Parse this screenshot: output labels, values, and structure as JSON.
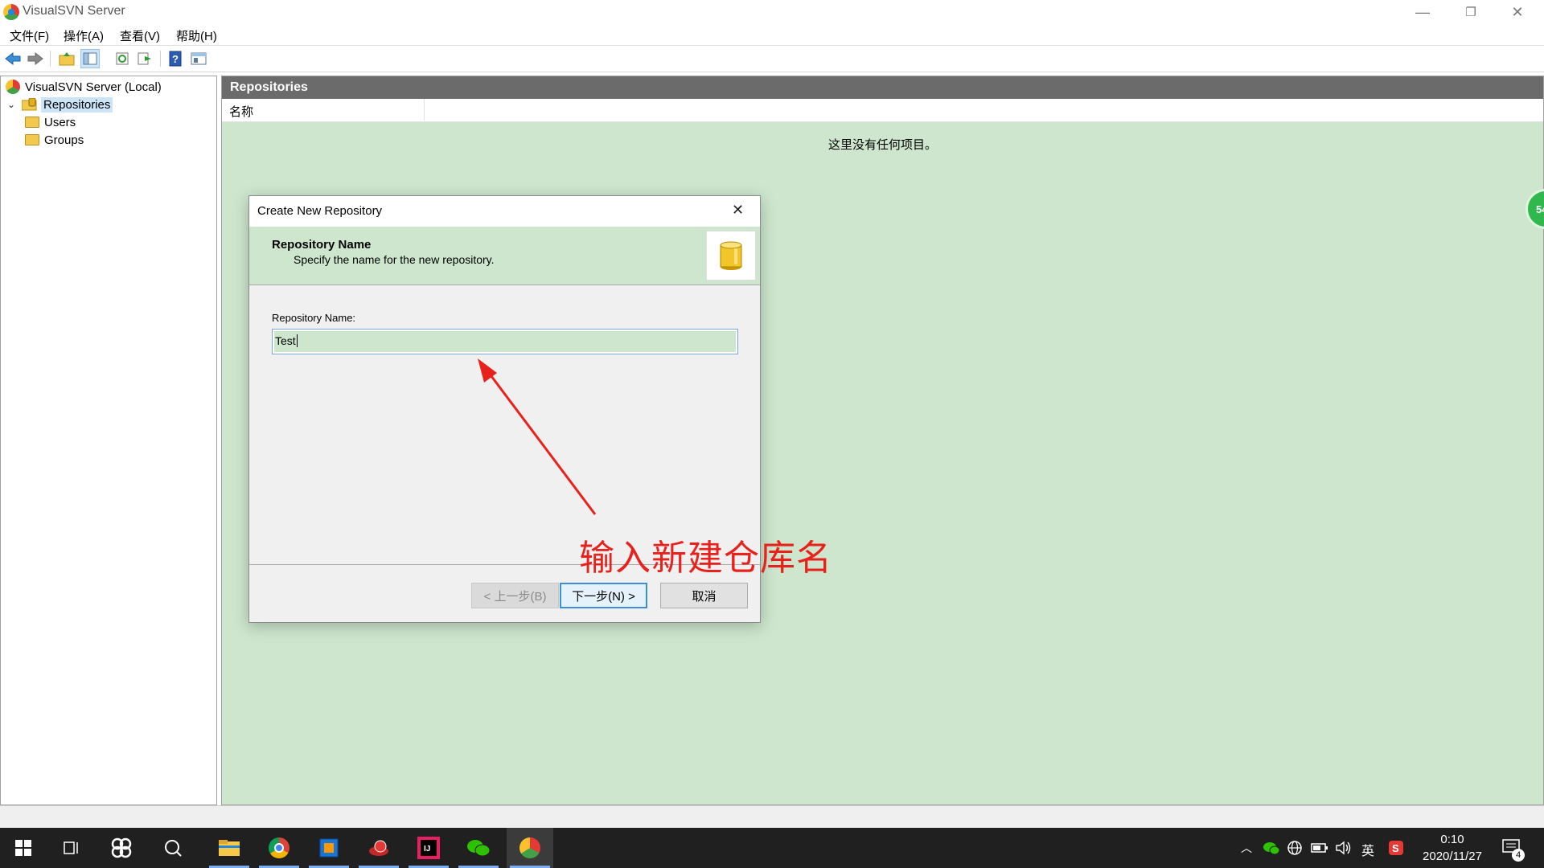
{
  "window": {
    "title": "VisualSVN Server",
    "minimize": "—",
    "restore": "❐",
    "close": "✕"
  },
  "menu": [
    "文件(F)",
    "操作(A)",
    "查看(V)",
    "帮助(H)"
  ],
  "tree": {
    "root": "VisualSVN Server (Local)",
    "items": [
      "Repositories",
      "Users",
      "Groups"
    ],
    "expand_glyph": "⌄"
  },
  "panel": {
    "header": "Repositories",
    "column_name": "名称",
    "empty_text": "这里没有任何项目。",
    "badge": "54"
  },
  "dialog": {
    "title": "Create New Repository",
    "close": "✕",
    "heading": "Repository Name",
    "subheading": "Specify the name for the new repository.",
    "field_label": "Repository Name:",
    "field_value": "Test",
    "back_button": "< 上一步(B)",
    "next_button": "下一步(N) >",
    "cancel_button": "取消"
  },
  "annotation": "输入新建仓库名",
  "taskbar": {
    "time": "0:10",
    "date": "2020/11/27",
    "ime": "英",
    "notifications": "4",
    "apps": [
      "start-icon",
      "task-view-icon",
      "baidu-netdisk-icon",
      "search-icon",
      "file-explorer-icon",
      "chrome-icon",
      "virtualbox-icon",
      "snail-app-icon",
      "intellij-idea-icon",
      "wechat-icon",
      "visualsvn-icon"
    ]
  },
  "colors": {
    "panel_bg": "#cde6cd",
    "header_bg": "#6b6b6b",
    "annotation": "#e8211c",
    "taskbar": "#202020"
  }
}
